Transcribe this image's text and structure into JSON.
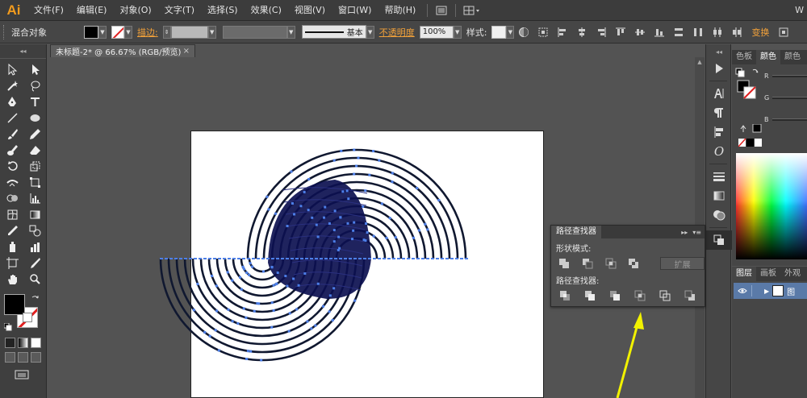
{
  "app": {
    "logo": "Ai",
    "corner_text": "W"
  },
  "menu": {
    "items": [
      "文件(F)",
      "编辑(E)",
      "对象(O)",
      "文字(T)",
      "选择(S)",
      "效果(C)",
      "视图(V)",
      "窗口(W)",
      "帮助(H)"
    ]
  },
  "control_bar": {
    "selection_label": "混合对象",
    "stroke_label": "描边:",
    "stroke_style": "基本",
    "opacity_label": "不透明度",
    "opacity_value": "100%",
    "style_label": "样式:",
    "transform_label": "变换"
  },
  "document_tab": {
    "title": "未标题-2* @ 66.67% (RGB/预览)",
    "close": "×"
  },
  "color_panel": {
    "tabs": [
      "色板",
      "颜色",
      "颜色"
    ],
    "active_tab": 1,
    "channels": [
      "R",
      "G",
      "B"
    ]
  },
  "layers_panel": {
    "tabs": [
      "图层",
      "画板",
      "外观"
    ],
    "layer_name": "图"
  },
  "pathfinder": {
    "tab": "路径查找器",
    "shape_modes_label": "形状模式:",
    "pathfinders_label": "路径查找器:",
    "expand_label": "扩展"
  },
  "colors": {
    "accent_orange": "#f29b1d",
    "selection_blue": "#4d7fe8",
    "arrow_yellow": "#f2f200"
  }
}
